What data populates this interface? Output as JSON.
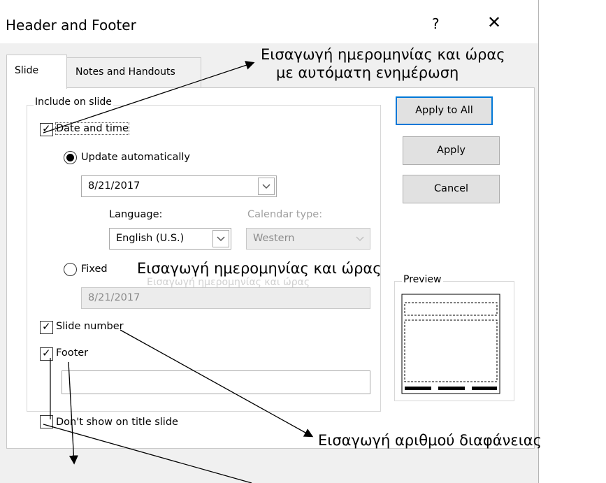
{
  "dialog": {
    "title": "Header and Footer",
    "help": "?",
    "close": "✕"
  },
  "tabs": [
    {
      "label": "Slide",
      "active": true
    },
    {
      "label": "Notes and Handouts",
      "active": false
    }
  ],
  "group": {
    "label": "Include on slide",
    "date_time": {
      "label": "Date and time",
      "checked": true
    },
    "update_auto": {
      "label": "Update automatically",
      "selected": true,
      "value": "8/21/2017"
    },
    "language": {
      "label": "Language:",
      "value": "English (U.S.)"
    },
    "calendar": {
      "label": "Calendar type:",
      "value": "Western"
    },
    "fixed": {
      "label": "Fixed",
      "selected": false,
      "value": "8/21/2017"
    },
    "slide_number": {
      "label": "Slide number",
      "checked": true
    },
    "footer": {
      "label": "Footer",
      "checked": true,
      "value": ""
    }
  },
  "dont_show": {
    "label": "Don't show on title slide",
    "checked": false
  },
  "buttons": {
    "apply_all": "Apply to All",
    "apply": "Apply",
    "cancel": "Cancel"
  },
  "preview": {
    "label": "Preview"
  },
  "annotations": {
    "top_line1": "Εισαγωγή ημερομηνίας και ώρας",
    "top_line2": "με αυτόματη ενημέρωση",
    "middle": "Εισαγωγή ημερομηνίας και ώρας",
    "middle_faded": "Εισαγωγή ημερομηνίας και ώρας",
    "bottom": "Εισαγωγή αριθμού διαφάνειας"
  }
}
